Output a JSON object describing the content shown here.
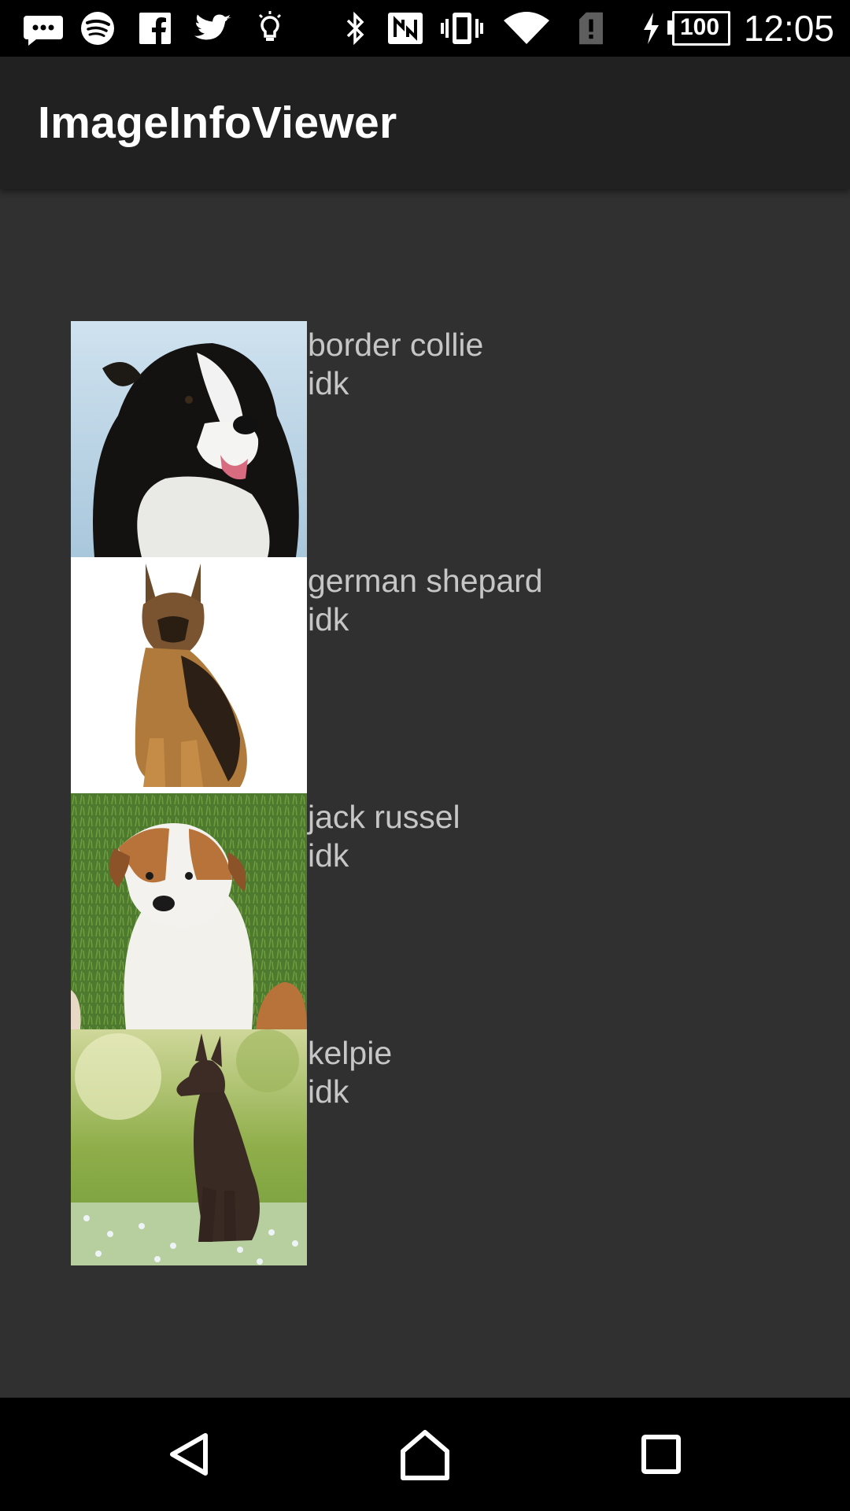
{
  "status_bar": {
    "time": "12:05",
    "battery": "100",
    "icons": [
      "chat-icon",
      "spotify-icon",
      "facebook-icon",
      "twitter-icon",
      "lightbulb-icon",
      "bluetooth-icon",
      "nfc-icon",
      "vibrate-icon",
      "wifi-icon",
      "sim-alert-icon",
      "charging-icon",
      "battery-icon"
    ]
  },
  "app_bar": {
    "title": "ImageInfoViewer"
  },
  "list": {
    "items": [
      {
        "name": "border collie",
        "info": "idk",
        "image": "border-collie-photo"
      },
      {
        "name": "german shepard",
        "info": "idk",
        "image": "german-shepherd-photo"
      },
      {
        "name": "jack russel",
        "info": "idk",
        "image": "jack-russell-photo"
      },
      {
        "name": "kelpie",
        "info": "idk",
        "image": "kelpie-photo"
      }
    ]
  },
  "nav_bar": {
    "buttons": [
      "back-icon",
      "home-icon",
      "recents-icon"
    ]
  },
  "colors": {
    "status_bar": "#000000",
    "app_bar": "#212121",
    "background": "#303030",
    "list_text": "#c6c6c6",
    "nav_bar": "#000000"
  }
}
